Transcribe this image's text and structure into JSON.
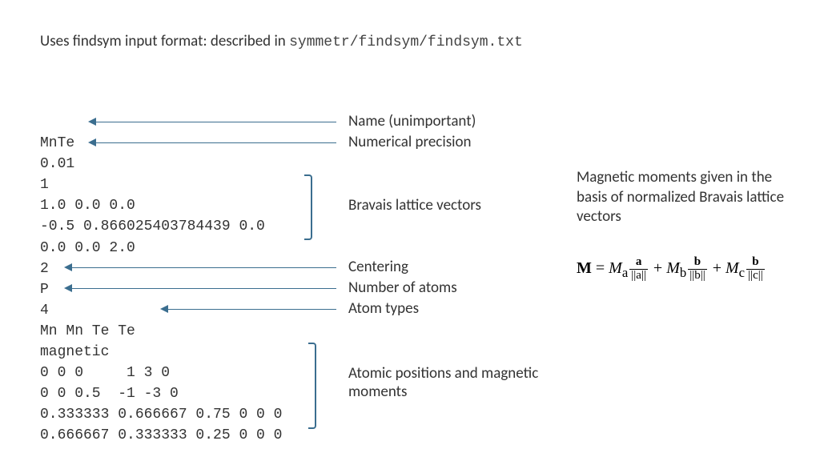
{
  "header": {
    "text_prefix": "Uses findsym input format: described in ",
    "path": "symmetr/findsym/findsym.txt"
  },
  "code": {
    "lines": [
      "MnTe",
      "0.01",
      "1",
      "1.0 0.0 0.0",
      "-0.5 0.866025403784439 0.0",
      "0.0 0.0 2.0",
      "2",
      "P",
      "4",
      "Mn Mn Te Te",
      "magnetic",
      "0 0 0     1 3 0",
      "0 0 0.5  -1 -3 0",
      "0.333333 0.666667 0.75 0 0 0",
      "0.666667 0.333333 0.25 0 0 0"
    ]
  },
  "annotations": {
    "name": "Name (unimportant)",
    "precision": "Numerical precision",
    "lattice": "Bravais lattice vectors",
    "centering": "Centering",
    "num_atoms": "Number of atoms",
    "atom_types": "Atom types",
    "positions": "Atomic positions and magnetic moments"
  },
  "side_note": "Magnetic moments given in the basis of normalized Bravais lattice vectors",
  "equation": {
    "M": "M",
    "eq": " = ",
    "Ma": "M",
    "a_sub": "a",
    "Mb": "M",
    "b_sub": "b",
    "Mc": "M",
    "c_sub": "c",
    "frac_a_num": "a",
    "frac_a_den": "||a||",
    "frac_b_num": "b",
    "frac_b_den": "||b||",
    "frac_c_num": "b",
    "frac_c_den": "||c||",
    "plus": " + "
  }
}
